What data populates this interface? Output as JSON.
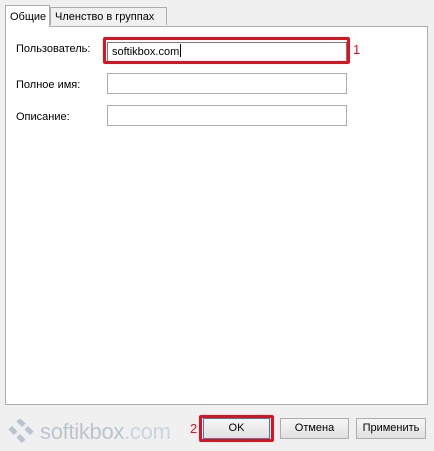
{
  "tabs": [
    {
      "label": "Общие",
      "active": true
    },
    {
      "label": "Членство в группах",
      "active": false
    }
  ],
  "form": {
    "user_label": "Пользователь:",
    "user_value": "softikbox.com",
    "fullname_label": "Полное имя:",
    "fullname_value": "",
    "description_label": "Описание:",
    "description_value": ""
  },
  "annotations": {
    "marker_1": "1",
    "marker_2": "2",
    "highlight_color": "#e0101e"
  },
  "buttons": {
    "ok": "OK",
    "cancel": "Отмена",
    "apply": "Применить"
  },
  "watermark": {
    "name": "softikbox",
    "suffix": ".com"
  }
}
